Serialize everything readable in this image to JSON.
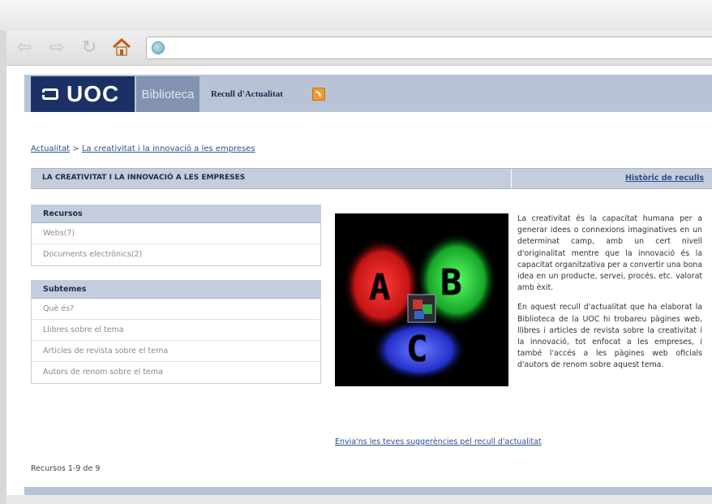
{
  "browser": {
    "back_icon": "back-arrow-icon",
    "forward_icon": "forward-arrow-icon",
    "reload_icon": "reload-icon",
    "home_icon": "home-icon",
    "address_value": ""
  },
  "header": {
    "logo_text": "UOC",
    "section_label": "Biblioteca",
    "subtitle": "Recull d'Actualitat"
  },
  "breadcrumb": {
    "root": "Actualitat",
    "separator": ">",
    "current": "La creativitat i la innovació a les empreses"
  },
  "title_bar": {
    "title": "LA CREATIVITAT I LA INNOVACIÓ A LES EMPRESES",
    "history_link": "Històric de reculls"
  },
  "recursos": {
    "heading": "Recursos",
    "items": [
      "Webs(7)",
      "Documents electrònics(2)"
    ]
  },
  "subtemes": {
    "heading": "Subtemes",
    "items": [
      "Què és?",
      "Llibres sobre el tema",
      "Articles de revista sobre el tema",
      "Autors de renom sobre el tema"
    ]
  },
  "description": {
    "p1": "La creativitat és la capacitat humana per a generar idees o connexions imaginatives en un determinat camp, amb un cert nivell d'originalitat mentre que la innovació és la capacitat organitzativa per a convertir una bona idea en un producte, servei, procés, etc. valorat amb èxit.",
    "p2": "En aquest recull d'actualitat que ha elaborat la Biblioteca de la UOC hi trobareu pàgines web, llibres i articles de revista sobre la creativitat i la innovació, tot enfocat a les empreses, i també l'accés a les pàgines web oficials d'autors de renom sobre aquest tema."
  },
  "footer": {
    "suggestions_link": "Envia'ns les teves suggerències pel recull d'actualitat",
    "results_count": "Recursos 1-9 de 9"
  },
  "colors": {
    "brand_dark": "#1b3166",
    "brand_mid": "#8293b1",
    "band": "#b8c4d6",
    "link": "#2c4f8f"
  }
}
